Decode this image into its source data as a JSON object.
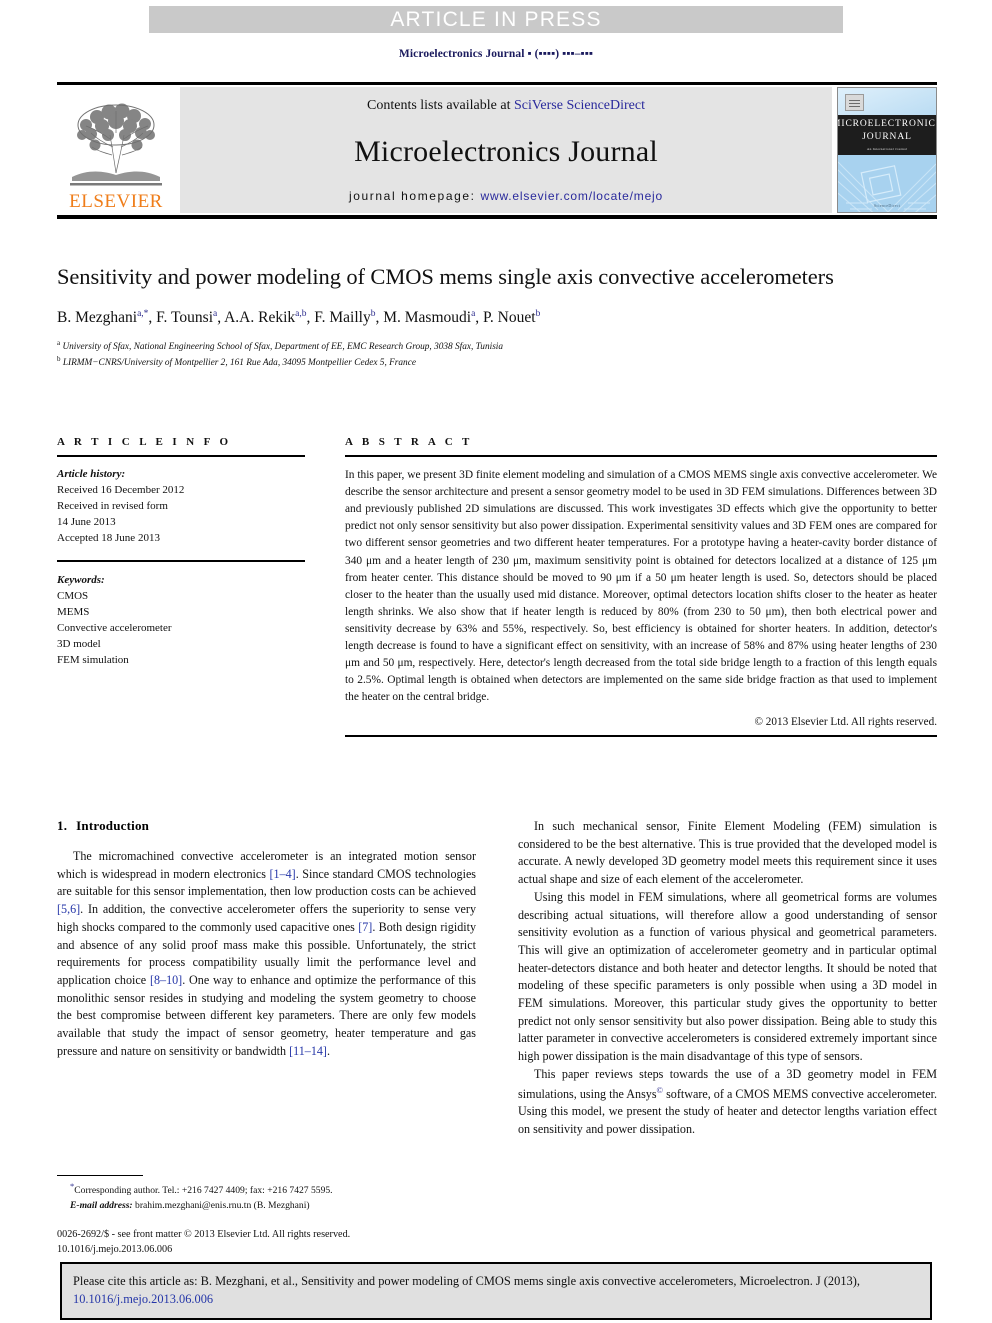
{
  "banner": {
    "text": "ARTICLE IN PRESS"
  },
  "running_head": {
    "text": "Microelectronics Journal ▪ (▪▪▪▪) ▪▪▪–▪▪▪"
  },
  "masthead": {
    "contents_prefix": "Contents lists available at ",
    "contents_link": "SciVerse ScienceDirect",
    "journal_title": "Microelectronics Journal",
    "homepage_label": "journal homepage: ",
    "homepage_link": "www.elsevier.com/locate/mejo",
    "publisher_wordmark": "ELSEVIER",
    "publisher_color": "#ef7d1a",
    "link_color": "#2a2a9c",
    "cover": {
      "line1": "MICROELECTRONICS",
      "line2": "JOURNAL",
      "sub": "An International Journal",
      "footer": "ScienceDirect"
    }
  },
  "article": {
    "title": "Sensitivity and power modeling of CMOS mems single axis convective accelerometers",
    "authors_html": "B. Mezghani<sup>a,*</sup>, F. Tounsi<sup>a</sup>, A.A. Rekik<sup>a,b</sup>, F. Mailly<sup>b</sup>, M. Masmoudi<sup>a</sup>, P. Nouet<sup>b</sup>",
    "affiliation_a": "University of Sfax, National Engineering School of Sfax, Department of EE, EMC Research Group, 3038 Sfax, Tunisia",
    "affiliation_b": "LIRMM−CNRS/University of Montpellier 2, 161 Rue Ada, 34095 Montpellier Cedex 5, France"
  },
  "info": {
    "heading": "A R T I C L E   I N F O",
    "history_label": "Article history:",
    "history_lines": [
      "Received 16 December 2012",
      "Received in revised form",
      "14 June 2013",
      "Accepted 18 June 2013"
    ],
    "keywords_label": "Keywords:",
    "keywords": [
      "CMOS",
      "MEMS",
      "Convective accelerometer",
      "3D model",
      "FEM simulation"
    ]
  },
  "abstract": {
    "heading": "A B S T R A C T",
    "text": "In this paper, we present 3D finite element modeling and simulation of a CMOS MEMS single axis convective accelerometer. We describe the sensor architecture and present a sensor geometry model to be used in 3D FEM simulations. Differences between 3D and previously published 2D simulations are discussed. This work investigates 3D effects which give the opportunity to better predict not only sensor sensitivity but also power dissipation. Experimental sensitivity values and 3D FEM ones are compared for two different sensor geometries and two different heater temperatures. For a prototype having a heater-cavity border distance of 340 μm and a heater length of 230 μm, maximum sensitivity point is obtained for detectors localized at a distance of 125 μm from heater center. This distance should be moved to 90 μm if a 50 μm heater length is used. So, detectors should be placed closer to the heater than the usually used mid distance. Moreover, optimal detectors location shifts closer to the heater as heater length shrinks. We also show that if heater length is reduced by 80% (from 230 to 50 μm), then both electrical power and sensitivity decrease by 63% and 55%, respectively. So, best efficiency is obtained for shorter heaters. In addition, detector's length decrease is found to have a significant effect on sensitivity, with an increase of 58% and 87% using heater lengths of 230 μm and 50 μm, respectively. Here, detector's length decreased from the total side bridge length to a fraction of this length equals to 2.5%. Optimal length is obtained when detectors are implemented on the same side bridge fraction as that used to implement the heater on the central bridge.",
    "copyright": "© 2013 Elsevier Ltd. All rights reserved."
  },
  "introduction": {
    "number": "1.",
    "title": "Introduction",
    "para1_a": "The micromachined convective accelerometer is an integrated motion sensor which is widespread in modern electronics ",
    "ref1": "[1–4]",
    "para1_b": ". Since standard CMOS technologies are suitable for this sensor implementation, then low production costs can be achieved ",
    "ref2": "[5,6]",
    "para1_c": ". In addition, the convective accelerometer offers the superiority to sense very high shocks compared to the commonly used capacitive ones ",
    "ref3": "[7]",
    "para1_d": ". Both design rigidity and absence of any solid proof mass make this possible. Unfortunately, the strict requirements for process compatibility usually limit the performance level and application choice ",
    "ref4": "[8–10]",
    "para1_e": ". One way to enhance and optimize the performance of this monolithic sensor resides in studying and modeling the system geometry to choose the best compromise between different key parameters. There are only few models available that study the impact of sensor geometry, heater temperature and gas pressure and nature on sensitivity or bandwidth ",
    "ref5": "[11–14]",
    "para1_f": "."
  },
  "right_column": {
    "para1": "In such mechanical sensor, Finite Element Modeling (FEM) simulation is considered to be the best alternative. This is true provided that the developed model is accurate. A newly developed 3D geometry model meets this requirement since it uses actual shape and size of each element of the accelerometer.",
    "para2": "Using this model in FEM simulations, where all geometrical forms are volumes describing actual situations, will therefore allow a good understanding of sensor sensitivity evolution as a function of various physical and geometrical parameters. This will give an optimization of accelerometer geometry and in particular optimal heater-detectors distance and both heater and detector lengths. It should be noted that modeling of these specific parameters is only possible when using a 3D model in FEM simulations. Moreover, this particular study gives the opportunity to better predict not only sensor sensitivity but also power dissipation. Being able to study this latter parameter in convective accelerometers is considered extremely important since high power dissipation is the main disadvantage of this type of sensors.",
    "para3_a": "This paper reviews steps towards the use of a 3D geometry model in FEM simulations, using the Ansys",
    "para3_sup": "©",
    "para3_b": " software, of a CMOS MEMS convective accelerometer. Using this model, we present the study of heater and detector lengths variation effect on sensitivity and power dissipation."
  },
  "footnote": {
    "corresponding": "Corresponding author. Tel.: +216 7427 4409; fax: +216 7427 5595.",
    "email_label": "E-mail address:",
    "email": "brahim.mezghani@enis.rnu.tn (B. Mezghani)"
  },
  "imprint": {
    "line1": "0026-2692/$ - see front matter © 2013 Elsevier Ltd. All rights reserved.",
    "line2": "10.1016/j.mejo.2013.06.006"
  },
  "cite_box": {
    "text_a": "Please cite this article as: B. Mezghani, et al., Sensitivity and power modeling of CMOS mems single axis convective accelerometers, Microelectron. J (2013), ",
    "doi": "10.1016/j.mejo.2013.06.006"
  }
}
